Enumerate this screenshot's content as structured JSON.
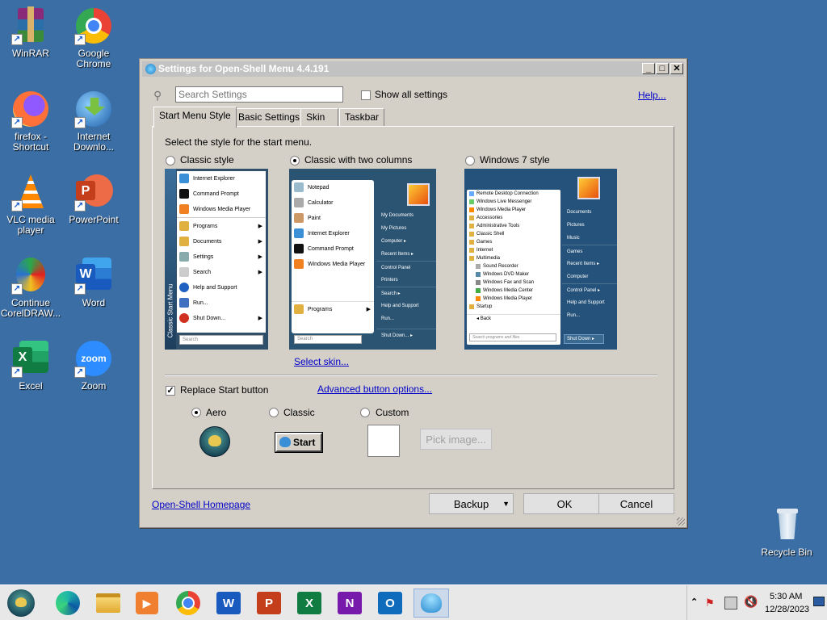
{
  "desktop": {
    "icons": [
      {
        "label": "WinRAR",
        "icon": "winrar-icon"
      },
      {
        "label": "Google Chrome",
        "icon": "chrome-icon"
      },
      {
        "label": "firefox - Shortcut",
        "icon": "firefox-icon"
      },
      {
        "label": "Internet Downlo...",
        "icon": "idm-icon"
      },
      {
        "label": "VLC media player",
        "icon": "vlc-icon"
      },
      {
        "label": "PowerPoint",
        "icon": "powerpoint-icon"
      },
      {
        "label": "Continue CorelDRAW...",
        "icon": "coreldraw-icon"
      },
      {
        "label": "Word",
        "icon": "word-icon"
      },
      {
        "label": "Excel",
        "icon": "excel-icon"
      },
      {
        "label": "Zoom",
        "icon": "zoom-icon"
      },
      {
        "label": "Recycle Bin",
        "icon": "recycle-bin-icon"
      }
    ]
  },
  "window": {
    "title": "Settings for Open-Shell Menu 4.4.191",
    "search_placeholder": "Search Settings",
    "show_all_label": "Show all settings",
    "help_label": "Help...",
    "tabs": [
      "Start Menu Style",
      "Basic Settings",
      "Skin",
      "Taskbar"
    ],
    "instruction": "Select the style for the start menu.",
    "styles": [
      "Classic style",
      "Classic with two columns",
      "Windows 7 style"
    ],
    "selected_style": "Classic with two columns",
    "select_skin": "Select skin...",
    "replace_start_label": "Replace Start button",
    "replace_start_checked": true,
    "advanced_button": "Advanced button options...",
    "button_styles": [
      "Aero",
      "Classic",
      "Custom"
    ],
    "selected_button_style": "Aero",
    "start_button_label": "Start",
    "pick_image": "Pick image...",
    "homepage_link": "Open-Shell Homepage",
    "backup": "Backup",
    "ok": "OK",
    "cancel": "Cancel"
  },
  "preview_classic": {
    "items": [
      "Internet Explorer",
      "Command Prompt",
      "Windows Media Player",
      "Programs",
      "Documents",
      "Settings",
      "Search",
      "Help and Support",
      "Run...",
      "Shut Down..."
    ],
    "side_text": "Classic Start Menu",
    "search": "Search"
  },
  "preview_two_col": {
    "left": [
      "Notepad",
      "Calculator",
      "Paint",
      "Internet Explorer",
      "Command Prompt",
      "Windows Media Player"
    ],
    "programs": "Programs",
    "search": "Search",
    "right": [
      "My Documents",
      "My Pictures",
      "Computer",
      "Recent Items",
      "Control Panel",
      "Printers",
      "Search",
      "Help and Support",
      "Run...",
      "Shut Down..."
    ]
  },
  "preview_win7": {
    "left": [
      "Remote Desktop Connection",
      "Windows Live Messenger",
      "Windows Media Player",
      "Accessories",
      "Administrative Tools",
      "Classic Shell",
      "Games",
      "Internet",
      "Multimedia",
      "Sound Recorder",
      "Windows DVD Maker",
      "Windows Fax and Scan",
      "Windows Media Center",
      "Windows Media Player",
      "Startup"
    ],
    "back": "Back",
    "search": "Search programs and files",
    "right": [
      "Documents",
      "Pictures",
      "Music",
      "Games",
      "Recent Items",
      "Computer",
      "Control Panel",
      "Help and Support",
      "Run..."
    ],
    "shutdown": "Shut Down"
  },
  "taskbar": {
    "apps": [
      "open-shell-start-icon",
      "edge-icon",
      "file-explorer-icon",
      "media-player-icon",
      "chrome-icon",
      "word-icon",
      "powerpoint-icon",
      "excel-icon",
      "onenote-icon",
      "outlook-icon",
      "open-shell-settings-icon"
    ],
    "time": "5:30 AM",
    "date": "12/28/2023"
  }
}
